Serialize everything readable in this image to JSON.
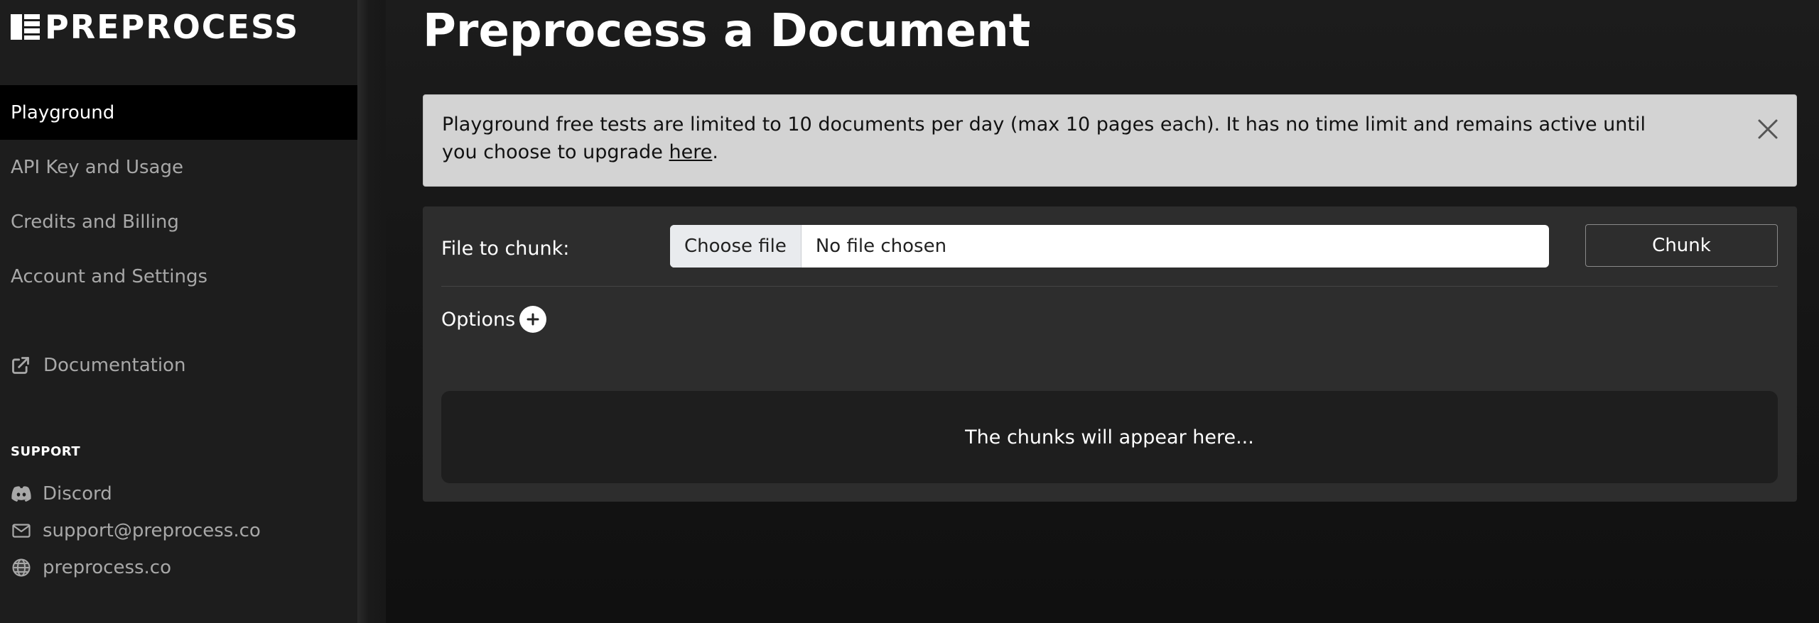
{
  "app": {
    "logo_text": "PREPROCESS"
  },
  "sidebar": {
    "items": [
      {
        "label": "Playground",
        "active": true
      },
      {
        "label": "API Key and Usage",
        "active": false
      },
      {
        "label": "Credits and Billing",
        "active": false
      },
      {
        "label": "Account and Settings",
        "active": false
      }
    ],
    "documentation": {
      "label": "Documentation",
      "icon": "external-link-icon"
    },
    "support_heading": "SUPPORT",
    "support": [
      {
        "label": "Discord",
        "icon": "discord-icon"
      },
      {
        "label": "support@preprocess.co",
        "icon": "mail-icon"
      },
      {
        "label": "preprocess.co",
        "icon": "globe-icon"
      }
    ]
  },
  "main": {
    "title": "Preprocess a Document",
    "notice": {
      "text_before": "Playground free tests are limited to 10 documents per day (max 10 pages each). It has no time limit and remains active until you choose to upgrade ",
      "link_text": "here",
      "text_after": "."
    },
    "form": {
      "file_label": "File to chunk:",
      "file_button": "Choose file",
      "file_status": "No file chosen",
      "submit_label": "Chunk",
      "options_label": "Options",
      "result_placeholder": "The chunks will appear here..."
    }
  },
  "colors": {
    "sidebar_bg": "#1d1d1d",
    "active_item_bg": "#000000",
    "notice_bg": "#d3d3d3",
    "panel_bg": "#2d2d2d",
    "result_bg": "#1e1e1e"
  }
}
